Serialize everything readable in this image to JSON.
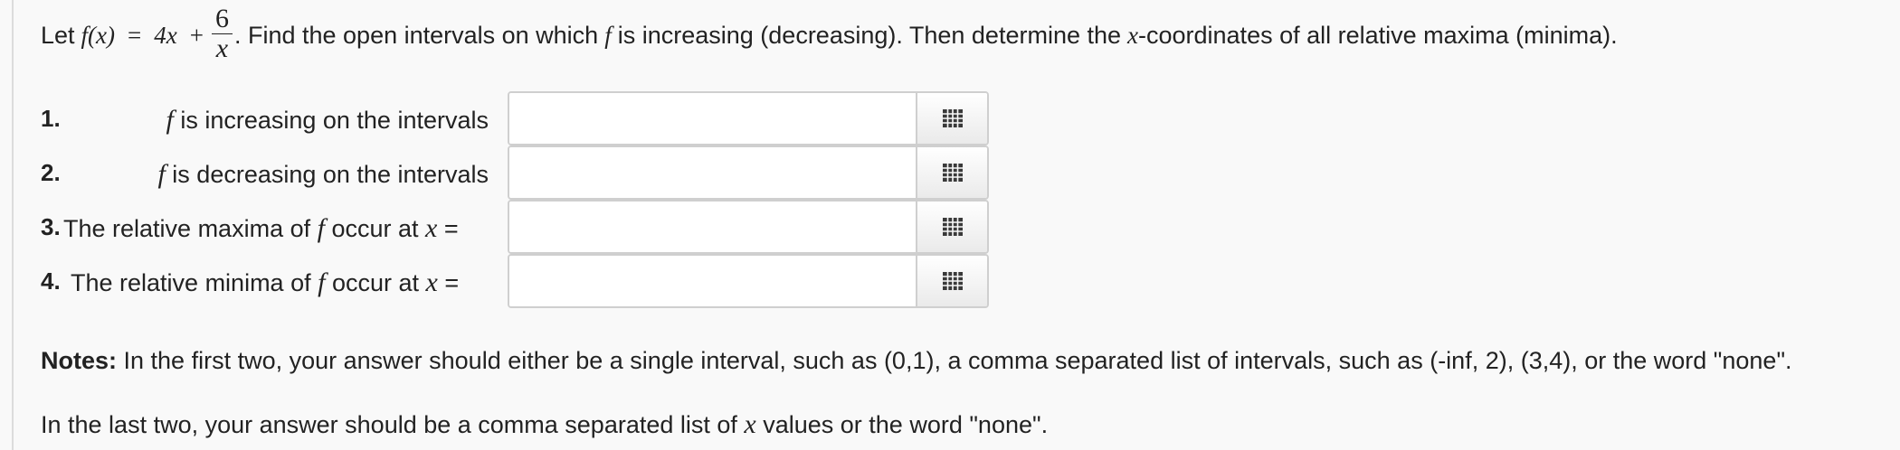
{
  "problem": {
    "lead": "Let",
    "func_lhs": "f(x)",
    "equals": "=",
    "term": "4x",
    "plus": "+",
    "frac_num": "6",
    "frac_den": "x",
    "rest_1": ". Find the open intervals on which",
    "f_symbol": "f",
    "rest_2": "is increasing (decreasing). Then determine the",
    "x_symbol": "x",
    "rest_3": "-coordinates of all relative maxima (minima)."
  },
  "questions": [
    {
      "number": "1.",
      "label_pre": "",
      "f": "f",
      "label_post": " is increasing on the intervals",
      "x": "",
      "suffix": "",
      "value": "",
      "palette_icon": "grid-palette-icon"
    },
    {
      "number": "2.",
      "label_pre": "",
      "f": "f",
      "label_post": " is decreasing on the intervals",
      "x": "",
      "suffix": "",
      "value": "",
      "palette_icon": "grid-palette-icon"
    },
    {
      "number": "3.",
      "label_pre": "The relative maxima of ",
      "f": "f",
      "label_post": " occur at ",
      "x": "x",
      "suffix": " =",
      "value": "",
      "palette_icon": "grid-palette-icon"
    },
    {
      "number": "4.",
      "label_pre": "The relative minima of ",
      "f": "f",
      "label_post": " occur at ",
      "x": "x",
      "suffix": " =",
      "value": "",
      "palette_icon": "grid-palette-icon"
    }
  ],
  "notes": {
    "bold": "Notes:",
    "text": " In the first two, your answer should either be a single interval, such as (0,1), a comma separated list of intervals, such as (-inf, 2), (3,4), or the word \"none\".",
    "last_pre": "In the last two, your answer should be a comma separated list of ",
    "last_x": "x",
    "last_post": " values or the word \"none\"."
  },
  "colors": {
    "background": "#f9f9f9",
    "text": "#222222",
    "input_border": "#cfcfcf"
  }
}
